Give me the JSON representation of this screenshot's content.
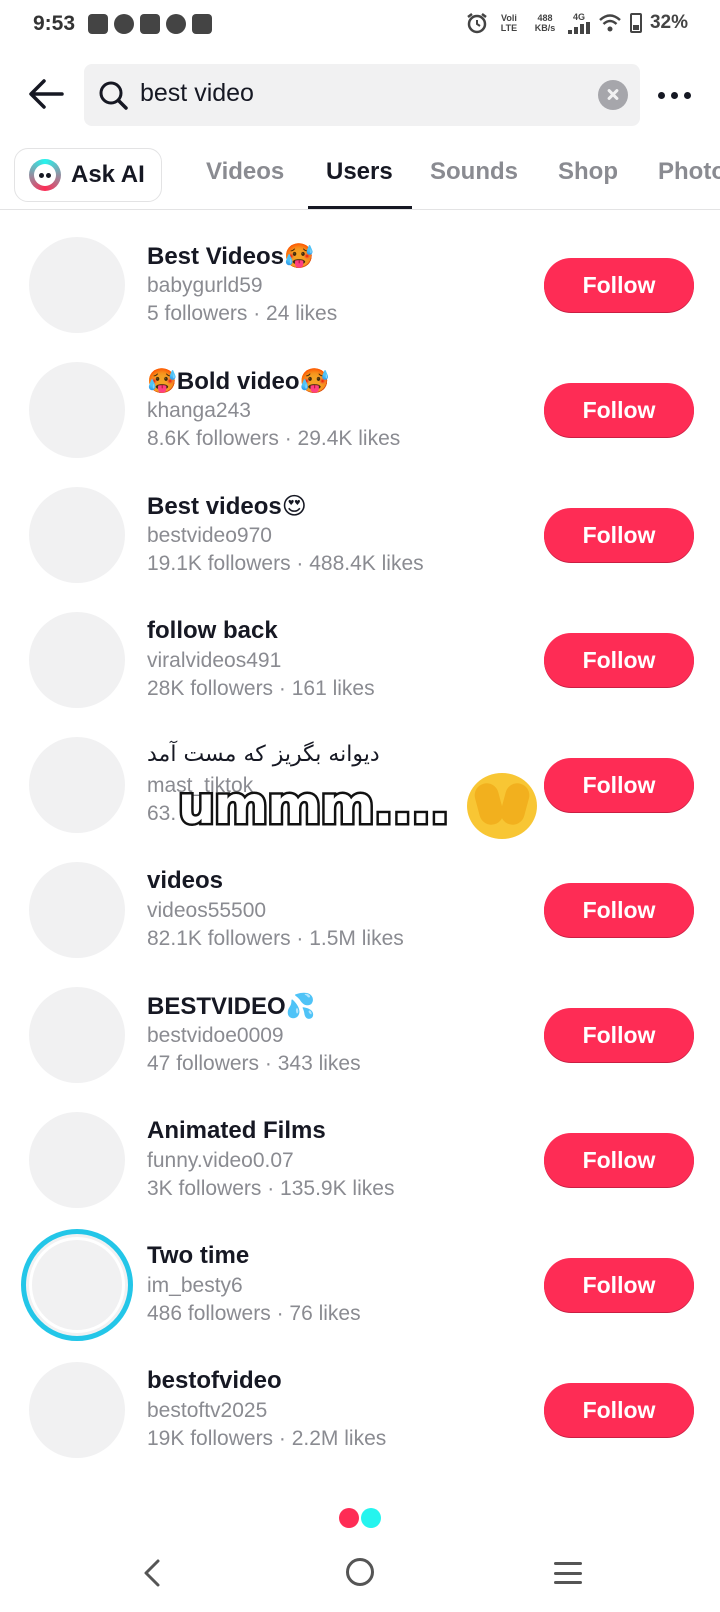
{
  "status_bar": {
    "time": "9:53",
    "network_type": "Voli LTE",
    "speed": "488 KB/s",
    "signal_type": "4G",
    "battery": "32%"
  },
  "search": {
    "query": "best video",
    "placeholder": "Search"
  },
  "tabs": {
    "ask_ai": "Ask AI",
    "items": [
      "Videos",
      "Users",
      "Sounds",
      "Shop",
      "Photos"
    ],
    "active": "Users"
  },
  "users": [
    {
      "name": "Best Videos🥵",
      "handle": "babygurld59",
      "stats": "5 followers · 24 likes",
      "button": "Follow"
    },
    {
      "name": "🥵Bold video🥵",
      "handle": "khanga243",
      "stats": "8.6K followers · 29.4K likes",
      "button": "Follow"
    },
    {
      "name": "Best videos😍",
      "handle": "bestvideo970",
      "stats": "19.1K followers · 488.4K likes",
      "button": "Follow"
    },
    {
      "name": "follow back",
      "handle": "viralvideos491",
      "stats": "28K followers · 161 likes",
      "button": "Follow"
    },
    {
      "name": "دیوانه بگریز که مست آمد",
      "handle": "mast_tiktok",
      "stats": "63.",
      "button": "Follow"
    },
    {
      "name": "videos",
      "handle": "videos55500",
      "stats": "82.1K followers · 1.5M likes",
      "button": "Follow"
    },
    {
      "name": "BESTVIDEO💦",
      "handle": "bestvidoe0009",
      "stats": "47 followers · 343 likes",
      "button": "Follow"
    },
    {
      "name": "Animated Films",
      "handle": "funny.video0.07",
      "stats": "3K followers · 135.9K likes",
      "button": "Follow"
    },
    {
      "name": "Two time",
      "handle": "im_besty6",
      "stats": "486 followers · 76 likes",
      "button": "Follow"
    },
    {
      "name": "bestofvideo",
      "handle": "bestoftv2025",
      "stats": "19K followers · 2.2M likes",
      "button": "Follow"
    }
  ],
  "sticker": {
    "text": "ummm....",
    "emoji_icon": "face-with-peeking-eye-icon"
  },
  "colors": {
    "accent": "#fe2c55",
    "secondary_accent": "#25f4ee",
    "text_primary": "#161823",
    "text_secondary": "#8a8b91"
  }
}
